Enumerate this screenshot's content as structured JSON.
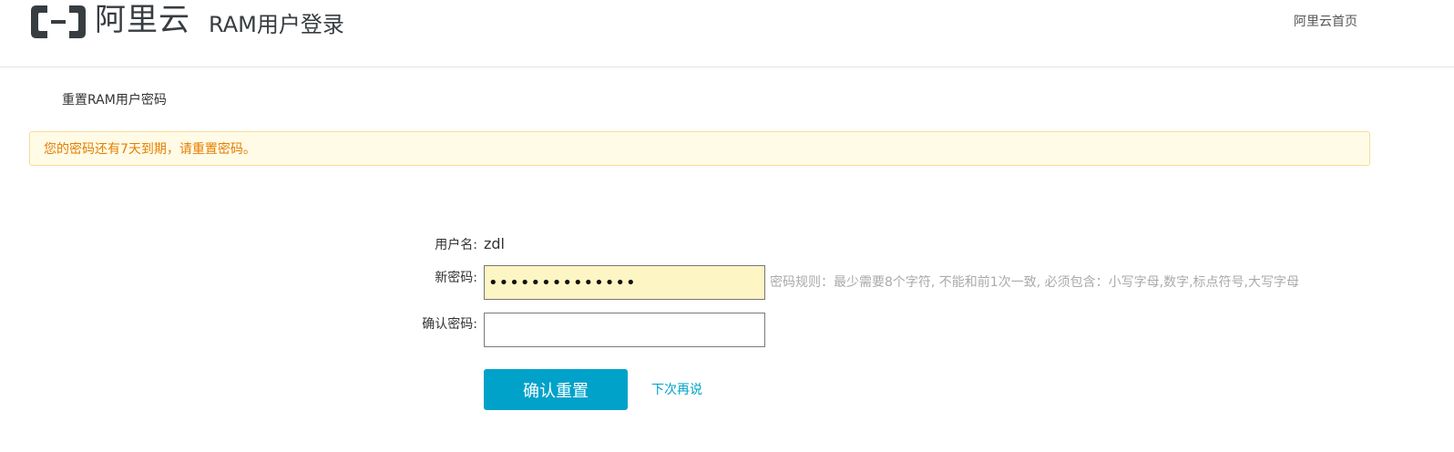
{
  "header": {
    "logo_text": "阿里云",
    "app_title": "RAM用户登录",
    "home_link": "阿里云首页"
  },
  "page": {
    "heading": "重置RAM用户密码"
  },
  "alert": {
    "message": "您的密码还有7天到期，请重置密码。",
    "color": "#e57e00",
    "background": "#fffbe6"
  },
  "form": {
    "username_label": "用户名:",
    "username_value": "zdl",
    "new_password_label": "新密码:",
    "new_password_value": "••••••••••••••",
    "password_rule_hint": "密码规则：最少需要8个字符, 不能和前1次一致, 必须包含：小写字母,数字,标点符号,大写字母",
    "confirm_password_label": "确认密码:",
    "confirm_password_value": "",
    "confirm_button": "确认重置",
    "skip_link": "下次再说"
  },
  "colors": {
    "accent": "#00a2ca",
    "logo": "#373d41"
  }
}
